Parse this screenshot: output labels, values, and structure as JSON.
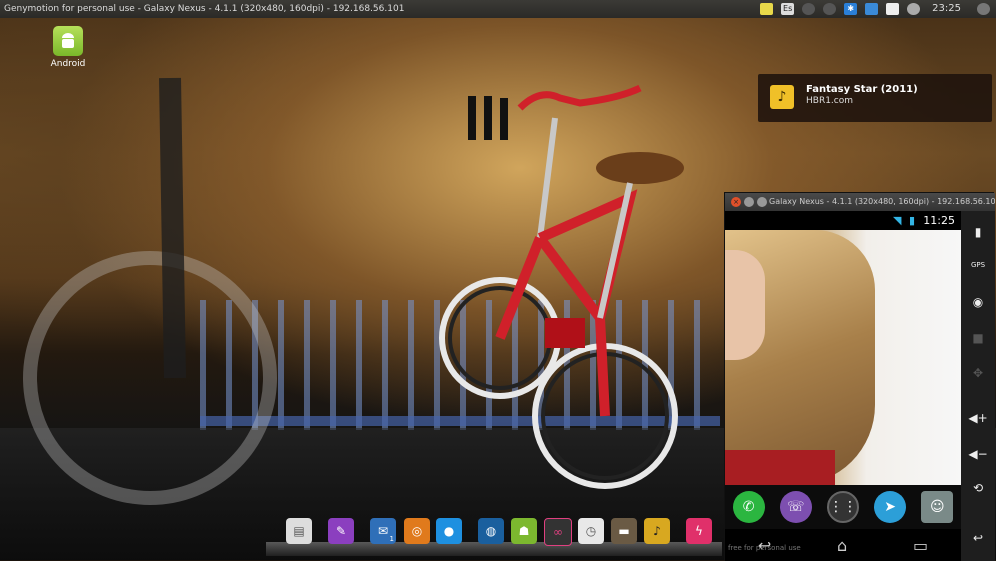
{
  "topbar": {
    "title": "Genymotion for personal use - Galaxy Nexus - 4.1.1 (320x480, 160dpi) - 192.168.56.101",
    "tray_keyboard": "Es",
    "clock": "23:25"
  },
  "desktop_icon": {
    "label": "Android"
  },
  "notification": {
    "title": "Fantasy Star (2011)",
    "subtitle": "HBR1.com"
  },
  "emulator": {
    "window_title": "Galaxy Nexus - 4.1.1 (320x480, 160dpi) - 192.168.56.101",
    "status_time": "11:25",
    "side_gps_label": "GPS",
    "dock_apps": [
      "whatsapp",
      "viber",
      "app-drawer",
      "telegram",
      "talking-tom"
    ]
  },
  "launcher": {
    "items": [
      "notes",
      "brush",
      "mail",
      "coins",
      "chat",
      "globe",
      "android",
      "glasses",
      "clock",
      "files",
      "music",
      "flash"
    ],
    "mail_badge": "1",
    "hint": "free for personal use"
  },
  "colors": {
    "accent": "#33b5e5",
    "notif_icon": "#f0c028",
    "bike_red": "#d0202a"
  }
}
